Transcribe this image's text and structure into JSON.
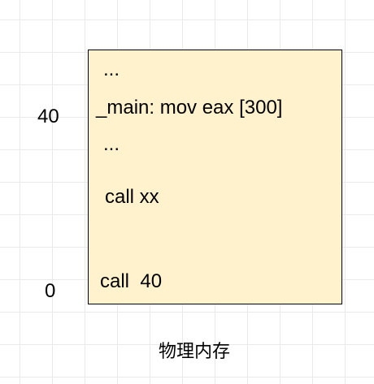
{
  "address_labels": {
    "top": "40",
    "bottom": "0"
  },
  "memory": {
    "lines": [
      "...",
      "_main: mov eax [300]",
      "...",
      "call xx",
      "call  40"
    ],
    "fill_color": "#fff2cc",
    "border_color": "#000000"
  },
  "caption": "物理内存",
  "grid_color": "#e9e9e9"
}
